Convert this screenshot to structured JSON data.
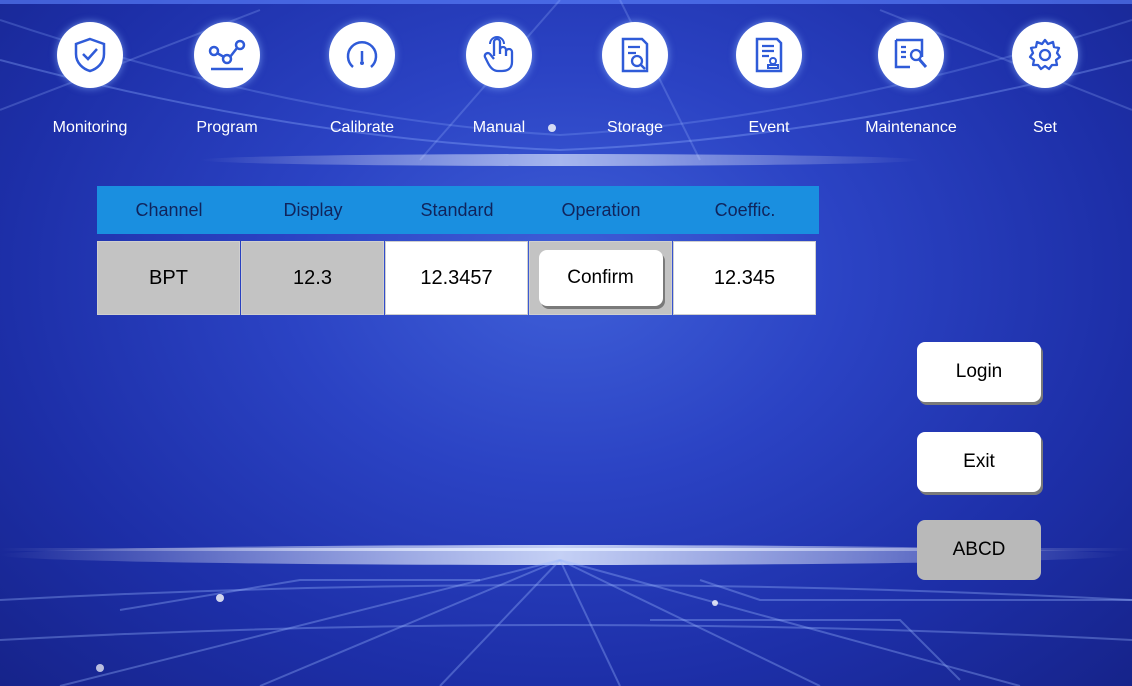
{
  "nav": [
    {
      "label": "Monitoring",
      "icon": "shield-check-icon"
    },
    {
      "label": "Program",
      "icon": "graph-nodes-icon"
    },
    {
      "label": "Calibrate",
      "icon": "gauge-icon"
    },
    {
      "label": "Manual",
      "icon": "hand-pointer-icon"
    },
    {
      "label": "Storage",
      "icon": "document-search-icon"
    },
    {
      "label": "Event",
      "icon": "document-stamp-icon"
    },
    {
      "label": "Maintenance",
      "icon": "maintenance-icon"
    },
    {
      "label": "Set",
      "icon": "gear-icon"
    }
  ],
  "table": {
    "headers": [
      "Channel",
      "Display",
      "Standard",
      "Operation",
      "Coeffic."
    ],
    "row": {
      "channel": "BPT",
      "display": "12.3",
      "standard": "12.3457",
      "operation_label": "Confirm",
      "coefficient": "12.345"
    }
  },
  "buttons": {
    "login": "Login",
    "exit": "Exit",
    "abcd": "ABCD"
  },
  "colors": {
    "icon": "#2f5bd8",
    "header_bg": "#1a8fe0",
    "background": "#2b43c4"
  }
}
